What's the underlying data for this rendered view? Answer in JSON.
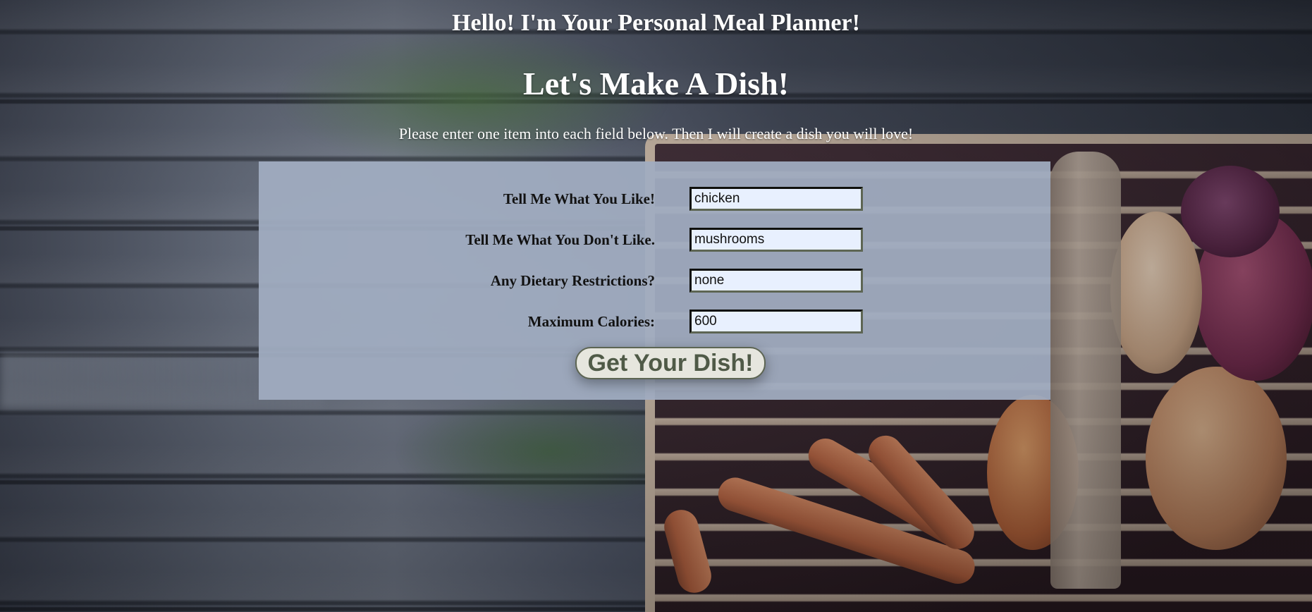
{
  "header": {
    "greeting": "Hello! I'm Your Personal Meal Planner!",
    "headline": "Let's Make A Dish!",
    "instructions": "Please enter one item into each field below. Then I will create a dish you will love!"
  },
  "form": {
    "fields": [
      {
        "label": "Tell Me What You Like!",
        "value": "chicken"
      },
      {
        "label": "Tell Me What You Don't Like.",
        "value": "mushrooms"
      },
      {
        "label": "Any Dietary Restrictions?",
        "value": "none"
      },
      {
        "label": "Maximum Calories:",
        "value": "600"
      }
    ],
    "submit_label": "Get Your Dish!"
  },
  "colors": {
    "panel_background": "#a0acc0",
    "field_background": "#e8f0fe",
    "field_border": "#5d6553",
    "button_text": "#4f5a47",
    "heading_text": "#ffffff"
  }
}
